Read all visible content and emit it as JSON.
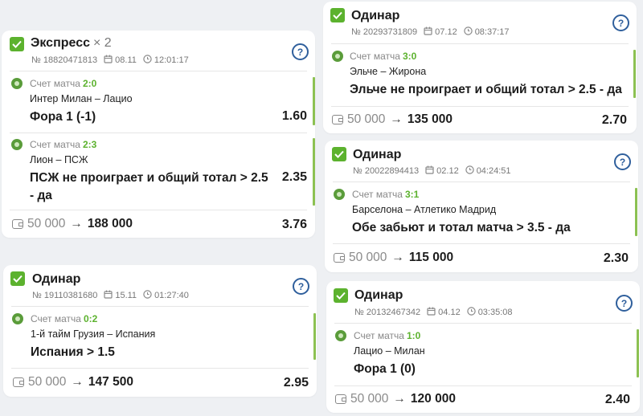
{
  "colors": {
    "accent": "#5cb22e",
    "help": "#2f5f9c",
    "bar": "#8cc152"
  },
  "cards": [
    {
      "title": "Экспресс",
      "mult": "× 2",
      "number": "№ 18820471813",
      "date": "08.11",
      "time": "12:01:17",
      "events": [
        {
          "score_label": "Счет матча",
          "score": "2:0",
          "match": "Интер Милан – Лацио",
          "bet": "Фора 1 (-1)",
          "odd": "1.60"
        },
        {
          "score_label": "Счет матча",
          "score": "2:3",
          "match": "Лион – ПСЖ",
          "bet": "ПСЖ не проиграет и общий тотал > 2.5 - да",
          "odd": "2.35"
        }
      ],
      "stake": "50 000",
      "arrow": "→",
      "win": "188 000",
      "total_odd": "3.76"
    },
    {
      "title": "Одинар",
      "number": "№ 19110381680",
      "date": "15.11",
      "time": "01:27:40",
      "events": [
        {
          "score_label": "Счет матча",
          "score": "0:2",
          "match": "1-й тайм Грузия – Испания",
          "bet": "Испания > 1.5",
          "odd": ""
        }
      ],
      "stake": "50 000",
      "arrow": "→",
      "win": "147 500",
      "total_odd": "2.95"
    },
    {
      "title": "Одинар",
      "number": "№ 20293731809",
      "date": "07.12",
      "time": "08:37:17",
      "events": [
        {
          "score_label": "Счет матча",
          "score": "3:0",
          "match": "Эльче – Жирона",
          "bet": "Эльче не проиграет и общий тотал > 2.5 - да",
          "odd": ""
        }
      ],
      "stake": "50 000",
      "arrow": "→",
      "win": "135 000",
      "total_odd": "2.70"
    },
    {
      "title": "Одинар",
      "number": "№ 20022894413",
      "date": "02.12",
      "time": "04:24:51",
      "events": [
        {
          "score_label": "Счет матча",
          "score": "3:1",
          "match": "Барселона – Атлетико Мадрид",
          "bet": "Обе забьют и тотал матча > 3.5 - да",
          "odd": ""
        }
      ],
      "stake": "50 000",
      "arrow": "→",
      "win": "115 000",
      "total_odd": "2.30"
    },
    {
      "title": "Одинар",
      "number": "№ 20132467342",
      "date": "04.12",
      "time": "03:35:08",
      "events": [
        {
          "score_label": "Счет матча",
          "score": "1:0",
          "match": "Лацио – Милан",
          "bet": "Фора 1 (0)",
          "odd": ""
        }
      ],
      "stake": "50 000",
      "arrow": "→",
      "win": "120 000",
      "total_odd": "2.40"
    }
  ]
}
